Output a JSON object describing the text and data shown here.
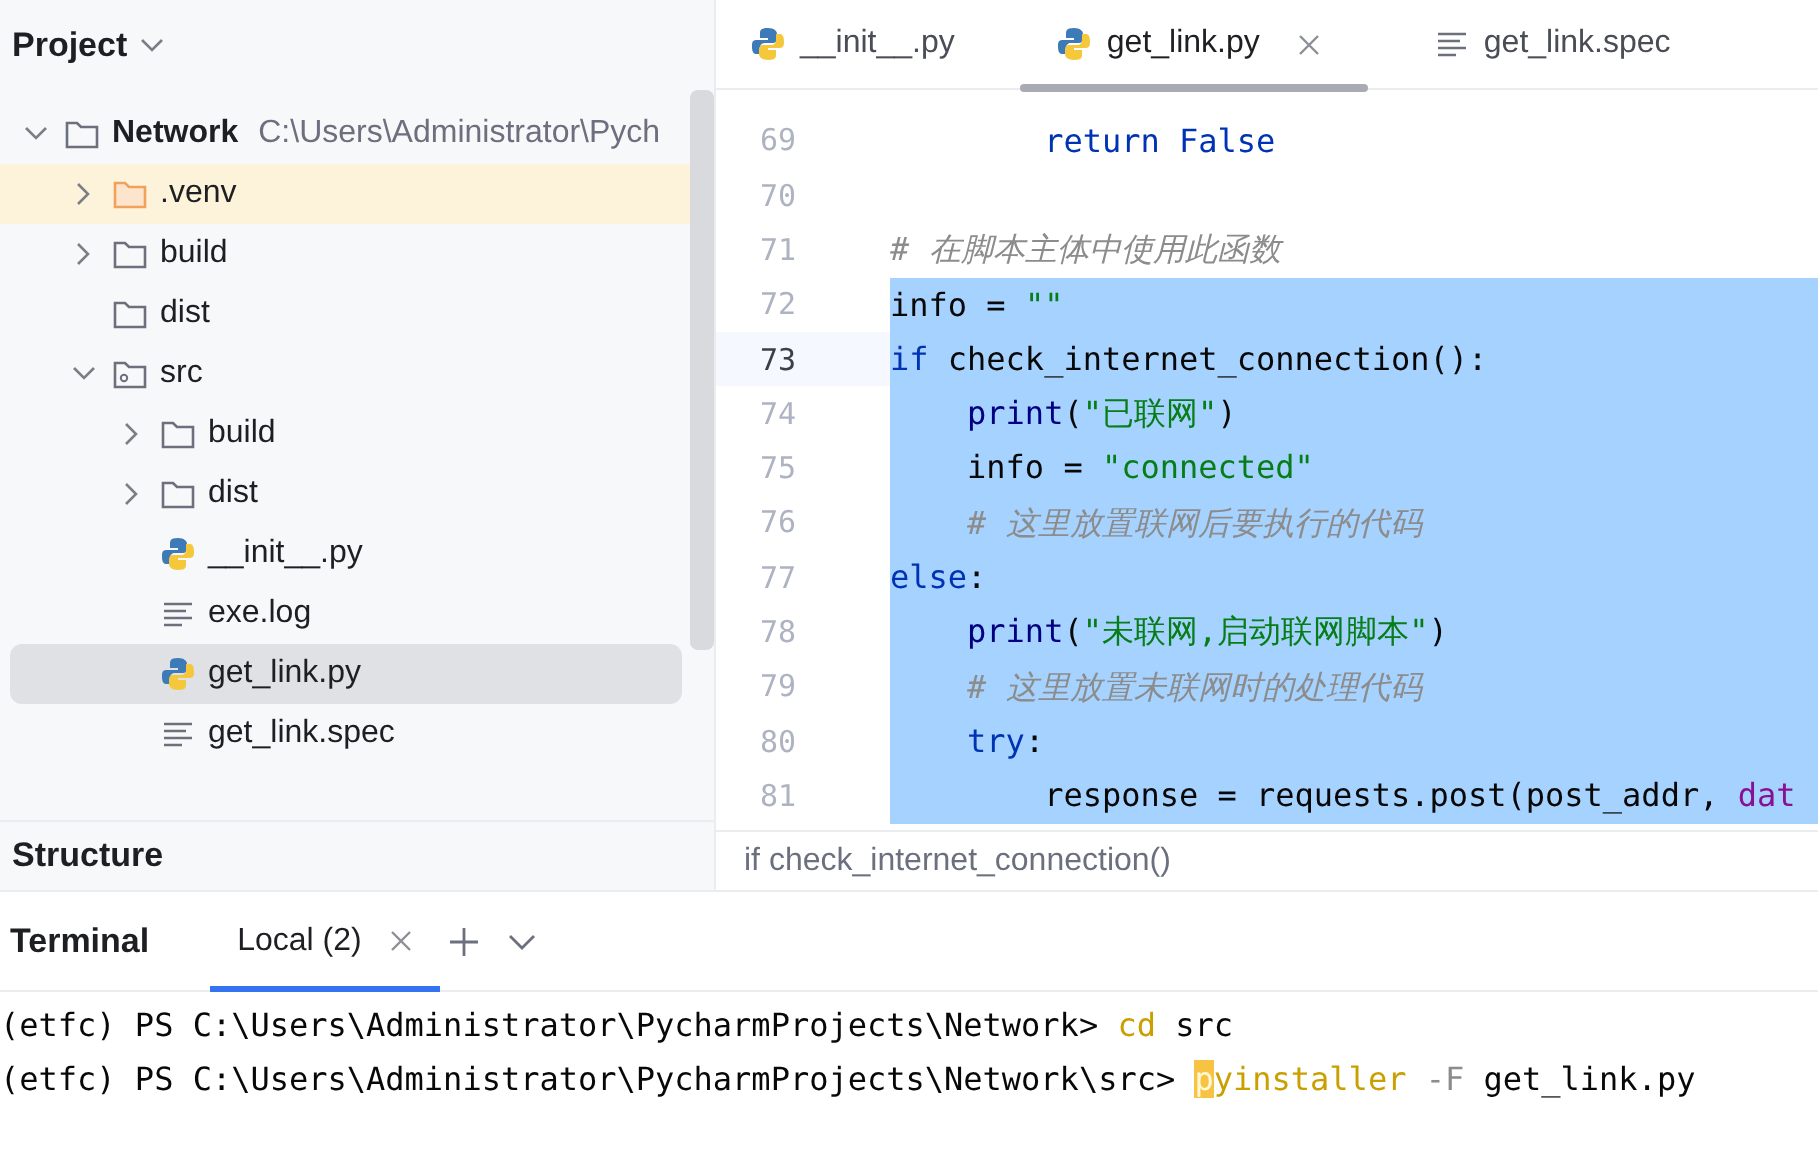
{
  "project_panel": {
    "title": "Project",
    "tree": [
      {
        "label": "Network",
        "path": "C:\\Users\\Administrator\\Pych",
        "kind": "folder",
        "expanded": true,
        "selected": false,
        "excluded": false,
        "children": [
          {
            "label": ".venv",
            "kind": "folder",
            "expanded": false,
            "selected": false,
            "excluded": true
          },
          {
            "label": "build",
            "kind": "folder",
            "expanded": false,
            "selected": false,
            "excluded": false
          },
          {
            "label": "dist",
            "kind": "folder",
            "selected": false,
            "excluded": false
          },
          {
            "label": "src",
            "kind": "source-folder",
            "expanded": true,
            "selected": false,
            "excluded": false,
            "children": [
              {
                "label": "build",
                "kind": "folder",
                "expanded": false,
                "selected": false,
                "excluded": false
              },
              {
                "label": "dist",
                "kind": "folder",
                "expanded": false,
                "selected": false,
                "excluded": false
              },
              {
                "label": "__init__.py",
                "kind": "python",
                "selected": false,
                "excluded": false
              },
              {
                "label": "exe.log",
                "kind": "text",
                "selected": false,
                "excluded": false
              },
              {
                "label": "get_link.py",
                "kind": "python",
                "selected": true,
                "excluded": false
              },
              {
                "label": "get_link.spec",
                "kind": "text",
                "selected": false,
                "excluded": false
              }
            ]
          }
        ]
      }
    ]
  },
  "structure_panel": {
    "title": "Structure"
  },
  "editor": {
    "tabs": [
      {
        "label": "__init__.py",
        "kind": "python",
        "selected": false
      },
      {
        "label": "get_link.py",
        "kind": "python",
        "selected": true
      },
      {
        "label": "get_link.spec",
        "kind": "text",
        "selected": false
      }
    ],
    "lines": [
      {
        "number": "69",
        "current": false,
        "selected": false,
        "tokens": [
          {
            "text": "        return False",
            "kind": "keyword"
          }
        ]
      },
      {
        "number": "70",
        "current": false,
        "selected": false
      },
      {
        "number": "71",
        "current": false,
        "selected": false,
        "tokens": [
          {
            "text": "# 在脚本主体中使用此函数",
            "kind": "comment"
          }
        ]
      },
      {
        "number": "72",
        "current": false,
        "selected": true,
        "tokens": [
          {
            "text": "info = ",
            "kind": "plain"
          },
          {
            "text": "\"\"",
            "kind": "string"
          }
        ]
      },
      {
        "number": "73",
        "current": true,
        "selected": true,
        "tokens": [
          {
            "text": "if",
            "kind": "keyword"
          },
          {
            "text": " check_internet_connection():",
            "kind": "plain"
          }
        ]
      },
      {
        "number": "74",
        "current": false,
        "selected": true,
        "tokens": [
          {
            "text": "    print",
            "kind": "builtin"
          },
          {
            "text": "(",
            "kind": "plain"
          },
          {
            "text": "\"已联网\"",
            "kind": "string"
          },
          {
            "text": ")",
            "kind": "plain"
          }
        ]
      },
      {
        "number": "75",
        "current": false,
        "selected": true,
        "tokens": [
          {
            "text": "    info = ",
            "kind": "plain"
          },
          {
            "text": "\"connected\"",
            "kind": "string"
          }
        ]
      },
      {
        "number": "76",
        "current": false,
        "selected": true,
        "tokens": [
          {
            "text": "    # 这里放置联网后要执行的代码",
            "kind": "comment"
          }
        ]
      },
      {
        "number": "77",
        "current": false,
        "selected": true,
        "tokens": [
          {
            "text": "else",
            "kind": "keyword"
          },
          {
            "text": ":",
            "kind": "plain"
          }
        ]
      },
      {
        "number": "78",
        "current": false,
        "selected": true,
        "tokens": [
          {
            "text": "    print",
            "kind": "builtin"
          },
          {
            "text": "(",
            "kind": "plain"
          },
          {
            "text": "\"未联网,启动联网脚本\"",
            "kind": "string"
          },
          {
            "text": ")",
            "kind": "plain"
          }
        ]
      },
      {
        "number": "79",
        "current": false,
        "selected": true,
        "tokens": [
          {
            "text": "    # 这里放置未联网时的处理代码",
            "kind": "comment"
          }
        ]
      },
      {
        "number": "80",
        "current": false,
        "selected": true,
        "tokens": [
          {
            "text": "    try",
            "kind": "keyword"
          },
          {
            "text": ":",
            "kind": "plain"
          }
        ]
      },
      {
        "number": "81",
        "current": false,
        "selected": true,
        "tokens": [
          {
            "text": "        response = requests.post(post_addr, ",
            "kind": "plain"
          },
          {
            "text": "dat",
            "kind": "param"
          }
        ]
      }
    ],
    "breadcrumb": "if check_internet_connection()"
  },
  "terminal": {
    "title": "Terminal",
    "tabs": [
      {
        "label": "Local (2)",
        "selected": true
      }
    ],
    "lines": [
      [
        {
          "text": "(etfc) PS C:\\Users\\Administrator\\PycharmProjects\\Network> ",
          "kind": "plain"
        },
        {
          "text": "cd",
          "kind": "command"
        },
        {
          "text": " src",
          "kind": "plain"
        }
      ],
      [
        {
          "text": "(etfc) PS C:\\Users\\Administrator\\PycharmProjects\\Network\\src> ",
          "kind": "plain"
        },
        {
          "text": "p",
          "kind": "cursor"
        },
        {
          "text": "yinstaller",
          "kind": "command"
        },
        {
          "text": " -F",
          "kind": "flag"
        },
        {
          "text": " get_link.py",
          "kind": "plain"
        }
      ]
    ]
  }
}
